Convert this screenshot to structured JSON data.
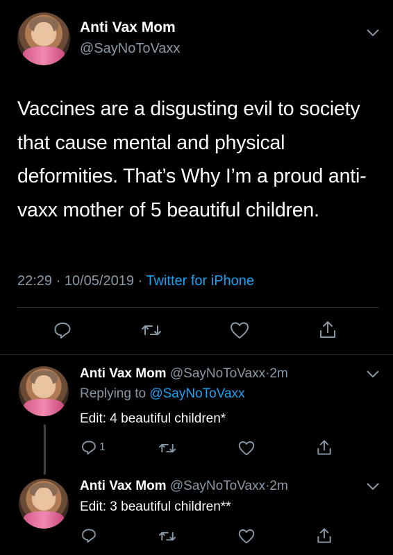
{
  "main": {
    "name": "Anti Vax Mom",
    "handle": "@SayNoToVaxx",
    "text": "Vaccines are a disgusting evil to society that cause mental and physical deformities. That’s Why I’m a proud anti-vaxx mother of 5 beautiful children.",
    "time": "22:29",
    "date": "10/05/2019",
    "separator": "·",
    "source": "Twitter for iPhone"
  },
  "replies": [
    {
      "name": "Anti Vax Mom",
      "handle": "@SayNoToVaxx",
      "age": "2m",
      "separator": "·",
      "replying_prefix": "Replying to",
      "replying_to": "@SayNoToVaxx",
      "text": "Edit: 4 beautiful children*",
      "reply_count": "1"
    },
    {
      "name": "Anti Vax Mom",
      "handle": "@SayNoToVaxx",
      "age": "2m",
      "separator": "·",
      "text": "Edit: 3 beautiful children**"
    }
  ],
  "icons": [
    "reply-icon",
    "retweet-icon",
    "like-icon",
    "share-icon",
    "chevron-down-icon"
  ],
  "colors": {
    "background": "#000000",
    "muted": "#8899a6",
    "link": "#1da1f2",
    "divider": "#2f3336"
  }
}
